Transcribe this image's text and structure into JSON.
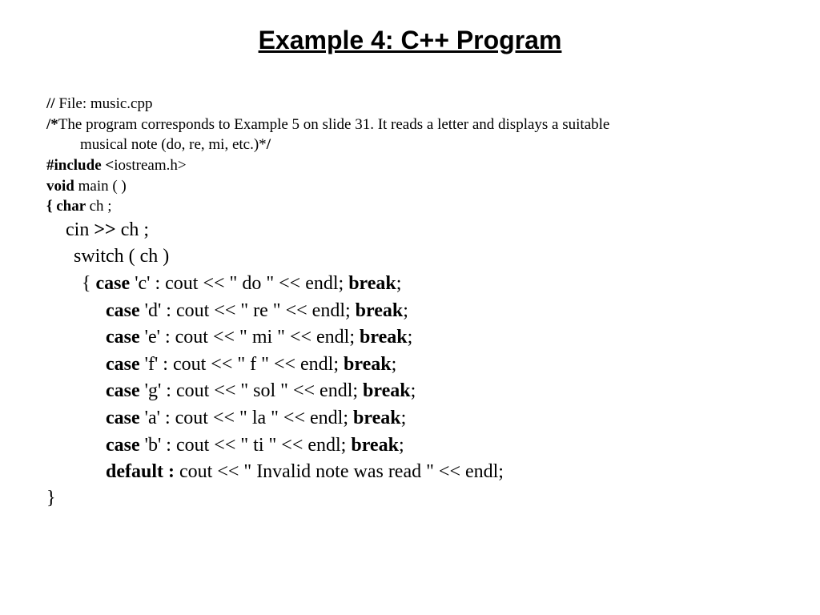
{
  "title": "Example 4: C++ Program",
  "code": {
    "comment1_prefix": "// ",
    "comment1_text": "File: music.cpp",
    "desc_open": "/*",
    "desc_text": "The program corresponds to Example 5 on slide 31. It reads a letter and displays a suitable",
    "desc_line2": "musical note (do, re, mi, etc.)*",
    "desc_close": "/",
    "include_kw": "#include <",
    "include_val": "iostream.h>",
    "void_kw": "void ",
    "main_text": "main ( )",
    "open_brace_char": "{ char ",
    "ch_decl": "ch ;",
    "cin_text": "cin ",
    "cin_op": ">> ",
    "cin_rest": "ch ;",
    "switch_text": "switch  ( ch )",
    "case_open": "{ ",
    "case_kw": "case ",
    "break_kw": "break",
    "semicolon": ";",
    "c_case": "'c' : cout <<  \" do \" << endl; ",
    "d_case": "'d' : cout <<  \" re \" << endl; ",
    "e_case": "'e' : cout <<  \" mi \" << endl; ",
    "f_case": "'f' : cout <<  \" f \" << endl; ",
    "g_case": "'g' : cout <<  \" sol \" << endl; ",
    "a_case": "'a' : cout <<  \" la \" << endl; ",
    "b_case": "'b' : cout <<  \" ti \" << endl; ",
    "default_kw": "default :",
    "default_text": "  cout << \" Invalid note was read \" << endl;",
    "close_brace": "}"
  }
}
